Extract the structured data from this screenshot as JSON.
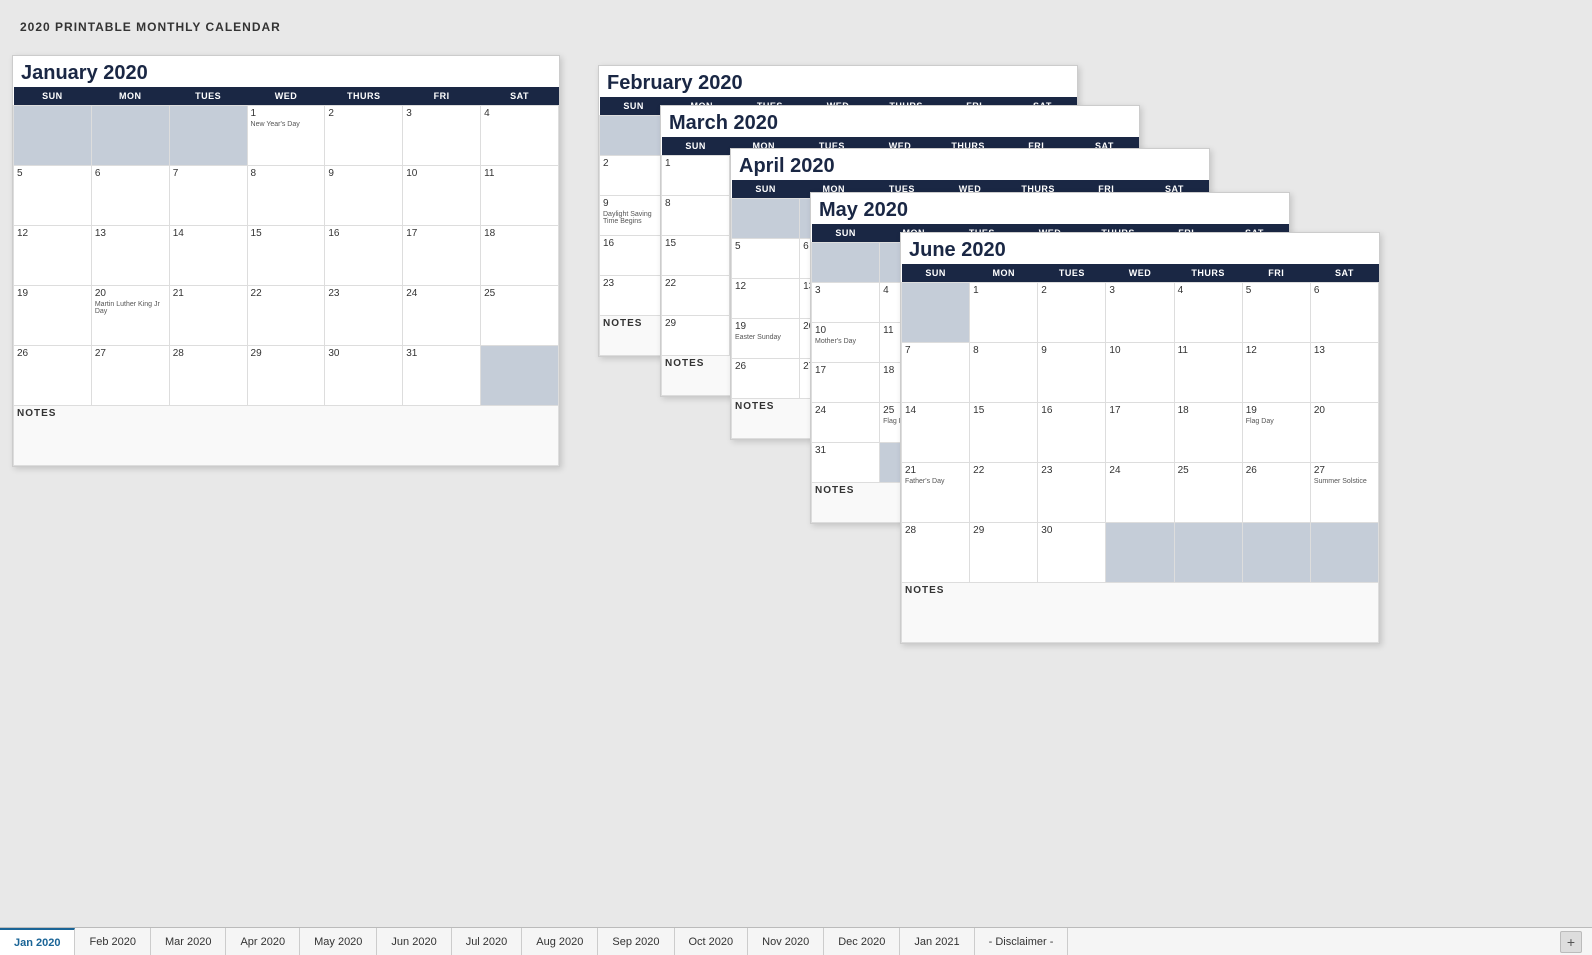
{
  "pageTitle": "2020 PRINTABLE MONTHLY CALENDAR",
  "calendars": {
    "january": {
      "title": "January 2020",
      "days": [
        "SUN",
        "MON",
        "TUES",
        "WED",
        "THURS",
        "FRI",
        "SAT"
      ],
      "weeks": [
        [
          null,
          null,
          null,
          "1",
          "2",
          "3",
          "4"
        ],
        [
          "5",
          "6",
          "7",
          "8",
          "9",
          "10",
          "11"
        ],
        [
          "12",
          "13",
          "14",
          "15",
          "16",
          "17",
          "18"
        ],
        [
          "19",
          "20",
          "21",
          "22",
          "23",
          "24",
          "25"
        ],
        [
          "26",
          "27",
          "28",
          "29",
          "30",
          "31",
          null
        ]
      ],
      "events": {
        "1": "New Year's Day",
        "20": "Martin Luther\nKing Jr Day"
      }
    },
    "february": {
      "title": "February 2020",
      "days": [
        "SUN",
        "MON",
        "TUES",
        "WED",
        "THURS",
        "FRI",
        "SAT"
      ]
    },
    "march": {
      "title": "March 2020",
      "days": [
        "SUN",
        "MON",
        "TUES",
        "WED",
        "THURS",
        "FRI",
        "SAT"
      ]
    },
    "april": {
      "title": "April 2020",
      "days": [
        "SUN",
        "MON",
        "TUES",
        "WED",
        "THURS",
        "FRI",
        "SAT"
      ]
    },
    "may": {
      "title": "May 2020",
      "days": [
        "SUN",
        "MON",
        "TUES",
        "WED",
        "THURS",
        "FRI",
        "SAT"
      ]
    },
    "june": {
      "title": "June 2020",
      "days": [
        "SUN",
        "MON",
        "TUES",
        "WED",
        "THURS",
        "FRI",
        "SAT"
      ],
      "weeks": [
        [
          null,
          "1",
          "2",
          "3",
          "4",
          "5",
          "6"
        ],
        [
          "7",
          "8",
          "9",
          "10",
          "11",
          "12",
          "13"
        ],
        [
          "14",
          "15",
          "16",
          "17",
          "18",
          "19",
          "20"
        ],
        [
          "21",
          "22",
          "23",
          "24",
          "25",
          "26",
          "27"
        ],
        [
          "28",
          "29",
          "30",
          null,
          null,
          null,
          null
        ]
      ],
      "events": {
        "19": "Flag Day",
        "21": "Father's Day",
        "27": "Summer Solstice"
      }
    }
  },
  "tabs": [
    {
      "label": "Jan 2020",
      "active": true
    },
    {
      "label": "Feb 2020",
      "active": false
    },
    {
      "label": "Mar 2020",
      "active": false
    },
    {
      "label": "Apr 2020",
      "active": false
    },
    {
      "label": "May 2020",
      "active": false
    },
    {
      "label": "Jun 2020",
      "active": false
    },
    {
      "label": "Jul 2020",
      "active": false
    },
    {
      "label": "Aug 2020",
      "active": false
    },
    {
      "label": "Sep 2020",
      "active": false
    },
    {
      "label": "Oct 2020",
      "active": false
    },
    {
      "label": "Nov 2020",
      "active": false
    },
    {
      "label": "Dec 2020",
      "active": false
    },
    {
      "label": "Jan 2021",
      "active": false
    },
    {
      "label": "- Disclaimer -",
      "active": false
    }
  ]
}
